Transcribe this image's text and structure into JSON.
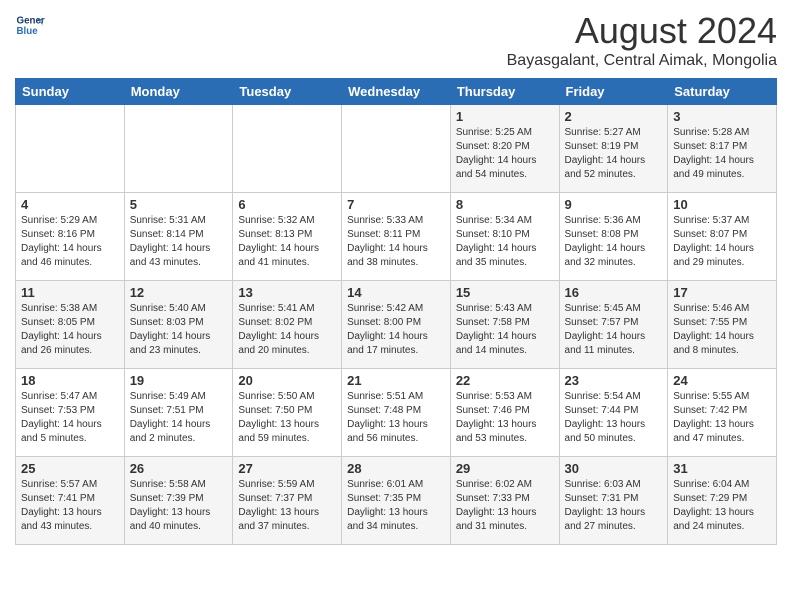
{
  "header": {
    "logo_general": "General",
    "logo_blue": "Blue",
    "month_year": "August 2024",
    "location": "Bayasgalant, Central Aimak, Mongolia"
  },
  "weekdays": [
    "Sunday",
    "Monday",
    "Tuesday",
    "Wednesday",
    "Thursday",
    "Friday",
    "Saturday"
  ],
  "weeks": [
    {
      "days": [
        {
          "num": "",
          "info": ""
        },
        {
          "num": "",
          "info": ""
        },
        {
          "num": "",
          "info": ""
        },
        {
          "num": "",
          "info": ""
        },
        {
          "num": "1",
          "info": "Sunrise: 5:25 AM\nSunset: 8:20 PM\nDaylight: 14 hours\nand 54 minutes."
        },
        {
          "num": "2",
          "info": "Sunrise: 5:27 AM\nSunset: 8:19 PM\nDaylight: 14 hours\nand 52 minutes."
        },
        {
          "num": "3",
          "info": "Sunrise: 5:28 AM\nSunset: 8:17 PM\nDaylight: 14 hours\nand 49 minutes."
        }
      ]
    },
    {
      "days": [
        {
          "num": "4",
          "info": "Sunrise: 5:29 AM\nSunset: 8:16 PM\nDaylight: 14 hours\nand 46 minutes."
        },
        {
          "num": "5",
          "info": "Sunrise: 5:31 AM\nSunset: 8:14 PM\nDaylight: 14 hours\nand 43 minutes."
        },
        {
          "num": "6",
          "info": "Sunrise: 5:32 AM\nSunset: 8:13 PM\nDaylight: 14 hours\nand 41 minutes."
        },
        {
          "num": "7",
          "info": "Sunrise: 5:33 AM\nSunset: 8:11 PM\nDaylight: 14 hours\nand 38 minutes."
        },
        {
          "num": "8",
          "info": "Sunrise: 5:34 AM\nSunset: 8:10 PM\nDaylight: 14 hours\nand 35 minutes."
        },
        {
          "num": "9",
          "info": "Sunrise: 5:36 AM\nSunset: 8:08 PM\nDaylight: 14 hours\nand 32 minutes."
        },
        {
          "num": "10",
          "info": "Sunrise: 5:37 AM\nSunset: 8:07 PM\nDaylight: 14 hours\nand 29 minutes."
        }
      ]
    },
    {
      "days": [
        {
          "num": "11",
          "info": "Sunrise: 5:38 AM\nSunset: 8:05 PM\nDaylight: 14 hours\nand 26 minutes."
        },
        {
          "num": "12",
          "info": "Sunrise: 5:40 AM\nSunset: 8:03 PM\nDaylight: 14 hours\nand 23 minutes."
        },
        {
          "num": "13",
          "info": "Sunrise: 5:41 AM\nSunset: 8:02 PM\nDaylight: 14 hours\nand 20 minutes."
        },
        {
          "num": "14",
          "info": "Sunrise: 5:42 AM\nSunset: 8:00 PM\nDaylight: 14 hours\nand 17 minutes."
        },
        {
          "num": "15",
          "info": "Sunrise: 5:43 AM\nSunset: 7:58 PM\nDaylight: 14 hours\nand 14 minutes."
        },
        {
          "num": "16",
          "info": "Sunrise: 5:45 AM\nSunset: 7:57 PM\nDaylight: 14 hours\nand 11 minutes."
        },
        {
          "num": "17",
          "info": "Sunrise: 5:46 AM\nSunset: 7:55 PM\nDaylight: 14 hours\nand 8 minutes."
        }
      ]
    },
    {
      "days": [
        {
          "num": "18",
          "info": "Sunrise: 5:47 AM\nSunset: 7:53 PM\nDaylight: 14 hours\nand 5 minutes."
        },
        {
          "num": "19",
          "info": "Sunrise: 5:49 AM\nSunset: 7:51 PM\nDaylight: 14 hours\nand 2 minutes."
        },
        {
          "num": "20",
          "info": "Sunrise: 5:50 AM\nSunset: 7:50 PM\nDaylight: 13 hours\nand 59 minutes."
        },
        {
          "num": "21",
          "info": "Sunrise: 5:51 AM\nSunset: 7:48 PM\nDaylight: 13 hours\nand 56 minutes."
        },
        {
          "num": "22",
          "info": "Sunrise: 5:53 AM\nSunset: 7:46 PM\nDaylight: 13 hours\nand 53 minutes."
        },
        {
          "num": "23",
          "info": "Sunrise: 5:54 AM\nSunset: 7:44 PM\nDaylight: 13 hours\nand 50 minutes."
        },
        {
          "num": "24",
          "info": "Sunrise: 5:55 AM\nSunset: 7:42 PM\nDaylight: 13 hours\nand 47 minutes."
        }
      ]
    },
    {
      "days": [
        {
          "num": "25",
          "info": "Sunrise: 5:57 AM\nSunset: 7:41 PM\nDaylight: 13 hours\nand 43 minutes."
        },
        {
          "num": "26",
          "info": "Sunrise: 5:58 AM\nSunset: 7:39 PM\nDaylight: 13 hours\nand 40 minutes."
        },
        {
          "num": "27",
          "info": "Sunrise: 5:59 AM\nSunset: 7:37 PM\nDaylight: 13 hours\nand 37 minutes."
        },
        {
          "num": "28",
          "info": "Sunrise: 6:01 AM\nSunset: 7:35 PM\nDaylight: 13 hours\nand 34 minutes."
        },
        {
          "num": "29",
          "info": "Sunrise: 6:02 AM\nSunset: 7:33 PM\nDaylight: 13 hours\nand 31 minutes."
        },
        {
          "num": "30",
          "info": "Sunrise: 6:03 AM\nSunset: 7:31 PM\nDaylight: 13 hours\nand 27 minutes."
        },
        {
          "num": "31",
          "info": "Sunrise: 6:04 AM\nSunset: 7:29 PM\nDaylight: 13 hours\nand 24 minutes."
        }
      ]
    }
  ]
}
